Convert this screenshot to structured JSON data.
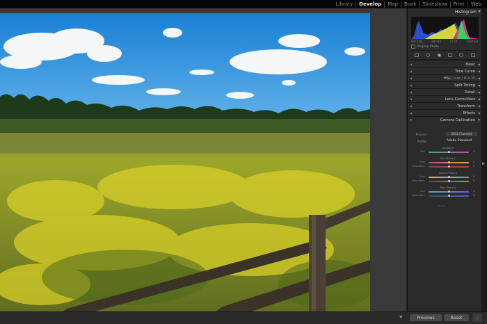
{
  "app": {
    "modules": [
      "Library",
      "Develop",
      "Map",
      "Book",
      "Slideshow",
      "Print",
      "Web"
    ],
    "active_module": "Develop"
  },
  "histogram": {
    "title": "Histogram",
    "info_left": "ISO 100",
    "info_mid": "28 mm",
    "info_mid2": "f / 11",
    "info_right": "1/50 sec",
    "original_photo": "Original Photo"
  },
  "panels": {
    "basic": "Basic",
    "tone_curve": "Tone Curve",
    "hsl": "HSL",
    "hsl_sub": "/ Color / B & W",
    "split_toning": "Split Toning",
    "detail": "Detail",
    "lens_corrections": "Lens Corrections",
    "transform": "Transform",
    "effects": "Effects",
    "camera_calibration": "Camera Calibration"
  },
  "calibration": {
    "process_label": "Process :",
    "process_value": "2012 (Current)",
    "profile_label": "Profile :",
    "profile_value": "Adobe Standard",
    "shadows": "Shadows",
    "tint": "Tint",
    "red_primary": "Red Primary",
    "green_primary": "Green Primary",
    "blue_primary": "Blue Primary",
    "hue": "Hue",
    "saturation": "Saturation",
    "zero": "0"
  },
  "toolbar": {
    "previous": "Previous",
    "reset": "Reset"
  },
  "colors": {
    "active_module": "#f0f0f0",
    "panel_bg": "#2b2b2b",
    "sky": "#1f86d6"
  }
}
